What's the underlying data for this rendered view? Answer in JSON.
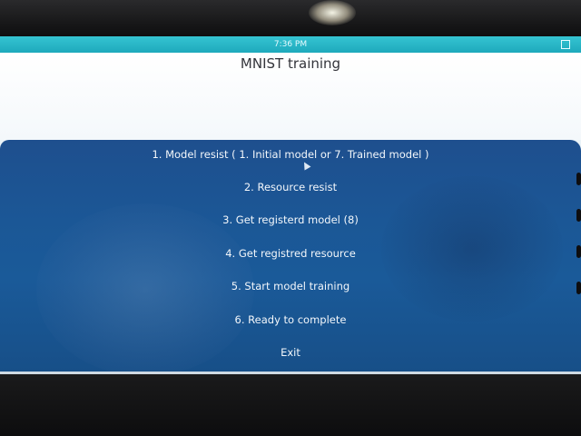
{
  "status_bar": {
    "time": "7:36 PM"
  },
  "app": {
    "title": "MNIST training"
  },
  "menu": {
    "items": [
      {
        "label": "1. Model resist ( 1. Initial model or 7. Trained model )"
      },
      {
        "label": "2. Resource resist"
      },
      {
        "label": "3. Get registerd model (8)"
      },
      {
        "label": "4. Get registred resource"
      },
      {
        "label": "5. Start model training"
      },
      {
        "label": "6. Ready to complete"
      },
      {
        "label": "Exit"
      }
    ]
  },
  "colors": {
    "status_bar": "#1ea9bc",
    "menu_background": "#1b5796",
    "title_background": "#ffffff"
  },
  "icons": {
    "status_right": "square-icon",
    "cursor": "mouse-cursor-icon"
  }
}
